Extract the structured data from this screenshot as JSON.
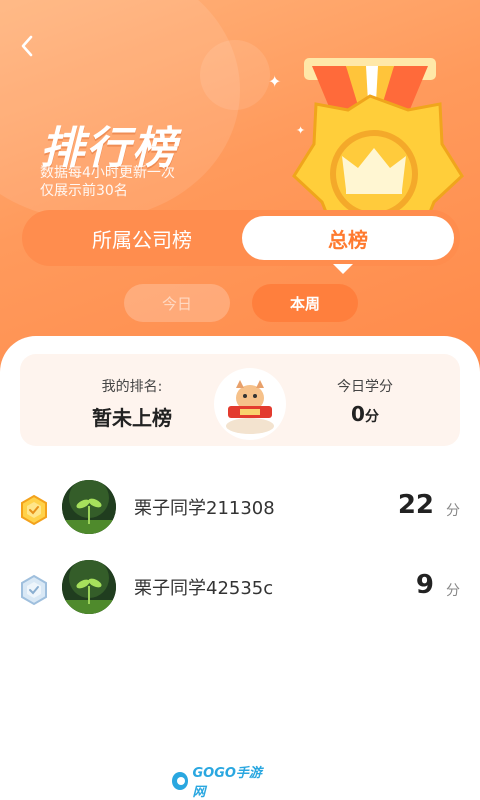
{
  "header": {
    "title": "排行榜",
    "subtitle_line1": "数据每4小时更新一次",
    "subtitle_line2": "仅展示前30名"
  },
  "tabs": [
    {
      "label": "所属公司榜",
      "active": false
    },
    {
      "label": "总榜",
      "active": true
    }
  ],
  "period": [
    {
      "label": "今日",
      "active": false
    },
    {
      "label": "本周",
      "active": true
    }
  ],
  "my_card": {
    "rank_label": "我的排名:",
    "rank_value": "暂未上榜",
    "study_label": "今日学分",
    "study_value": "0",
    "study_unit": "分"
  },
  "ranking": [
    {
      "rank": 1,
      "badge": "gold-badge-icon",
      "name": "栗子同学211308",
      "score": "22",
      "unit": "分"
    },
    {
      "rank": 2,
      "badge": "silver-badge-icon",
      "name": "栗子同学42535c",
      "score": "9",
      "unit": "分"
    }
  ],
  "watermark": "GOGO手游网",
  "colors": {
    "accent": "#ff7a2f",
    "hero": "#ff9a5c",
    "card_bg": "#fef4ee"
  }
}
